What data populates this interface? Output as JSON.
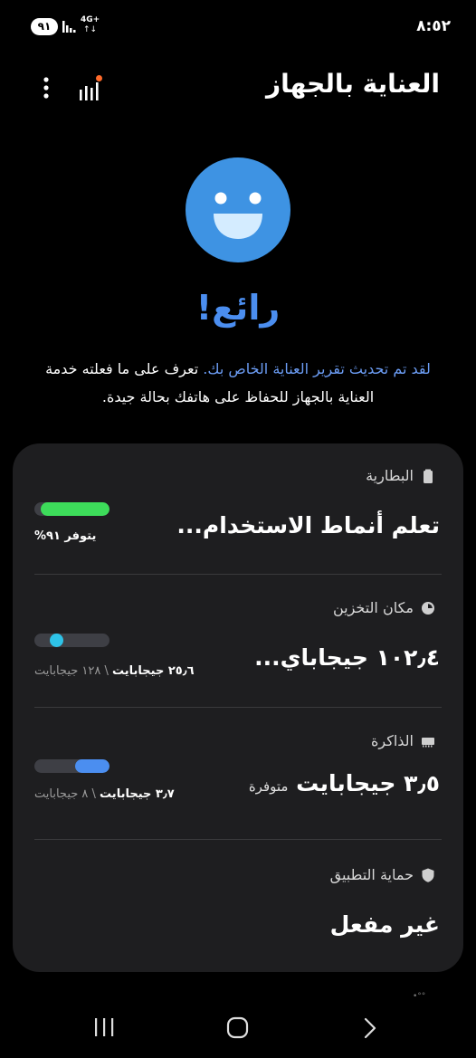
{
  "status_bar": {
    "battery_level": "٩١",
    "network_type": "4G+",
    "network_arrows": "↑↓",
    "time": "٨:٥٢"
  },
  "header": {
    "title": "العناية بالجهاز"
  },
  "hero": {
    "status_word": "رائع!",
    "description_link": "لقد تم تحديث تقرير العناية الخاص بك.",
    "description_rest": " تعرف على ما فعلته خدمة العناية بالجهاز للحفاظ على هاتفك بحالة جيدة."
  },
  "sections": {
    "battery": {
      "title": "البطارية",
      "value": "تعلم أنماط الاستخدام...",
      "available": "يتوفر ٩١%",
      "level": 0.91,
      "color": "#3ddc5a"
    },
    "storage": {
      "title": "مكان التخزين",
      "value": "١٠٢٫٤ جيجاباي...",
      "free": "٢٥٫٦ جيجابايت",
      "separator": " \\ ",
      "total": "١٢٨ جيجابايت",
      "used_fraction": 0.8,
      "color": "#2ec3e8"
    },
    "memory": {
      "title": "الذاكرة",
      "value": "٣٫٥ جيجابايت",
      "value_suffix": "متوفرة",
      "used": "٣٫٧ جيجابايت",
      "separator": " \\ ",
      "total": "٨ جيجابايت",
      "used_fraction": 0.46,
      "color": "#4b8ef0"
    },
    "app_protection": {
      "title": "حماية التطبيق",
      "value": "غير مفعل"
    }
  },
  "footer_dots": "•°°",
  "icons": {
    "more": "more-vertical-icon",
    "chart": "signal-chart-icon",
    "smiley": "smiley-face-icon",
    "battery": "battery-icon",
    "storage": "pie-chart-icon",
    "memory": "memory-chip-icon",
    "protection": "shield-icon",
    "nav_recents": "recent-apps-icon",
    "nav_home": "home-icon",
    "nav_back": "back-icon"
  }
}
